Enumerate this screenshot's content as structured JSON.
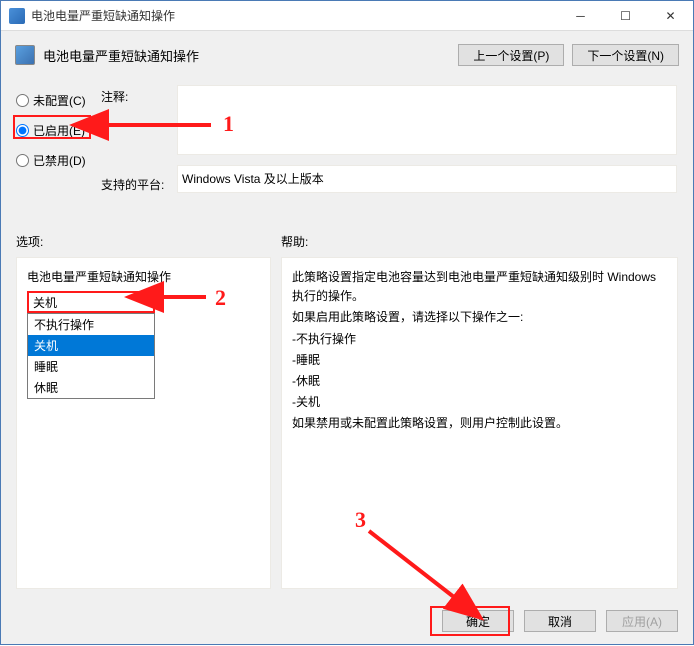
{
  "titlebar": {
    "title": "电池电量严重短缺通知操作"
  },
  "header": {
    "title": "电池电量严重短缺通知操作",
    "prev_btn": "上一个设置(P)",
    "next_btn": "下一个设置(N)"
  },
  "radios": {
    "not_configured": "未配置(C)",
    "enabled": "已启用(E)",
    "disabled": "已禁用(D)",
    "selected": "enabled"
  },
  "labels": {
    "comment": "注释:",
    "platform": "支持的平台:",
    "options": "选项:",
    "help": "帮助:"
  },
  "comment_value": "",
  "platform_value": "Windows Vista 及以上版本",
  "options_panel": {
    "title": "电池电量严重短缺通知操作",
    "dropdown_value": "关机",
    "dropdown_items": [
      "不执行操作",
      "关机",
      "睡眠",
      "休眠"
    ],
    "dropdown_selected_index": 1
  },
  "help_lines": [
    "此策略设置指定电池容量达到电池电量严重短缺通知级别时 Windows 执行的操作。",
    "",
    "如果启用此策略设置，请选择以下操作之一:",
    "-不执行操作",
    "-睡眠",
    "-休眠",
    "-关机",
    "",
    "如果禁用或未配置此策略设置，则用户控制此设置。"
  ],
  "footer": {
    "ok": "确定",
    "cancel": "取消",
    "apply": "应用(A)"
  },
  "annotations": {
    "n1": "1",
    "n2": "2",
    "n3": "3"
  }
}
